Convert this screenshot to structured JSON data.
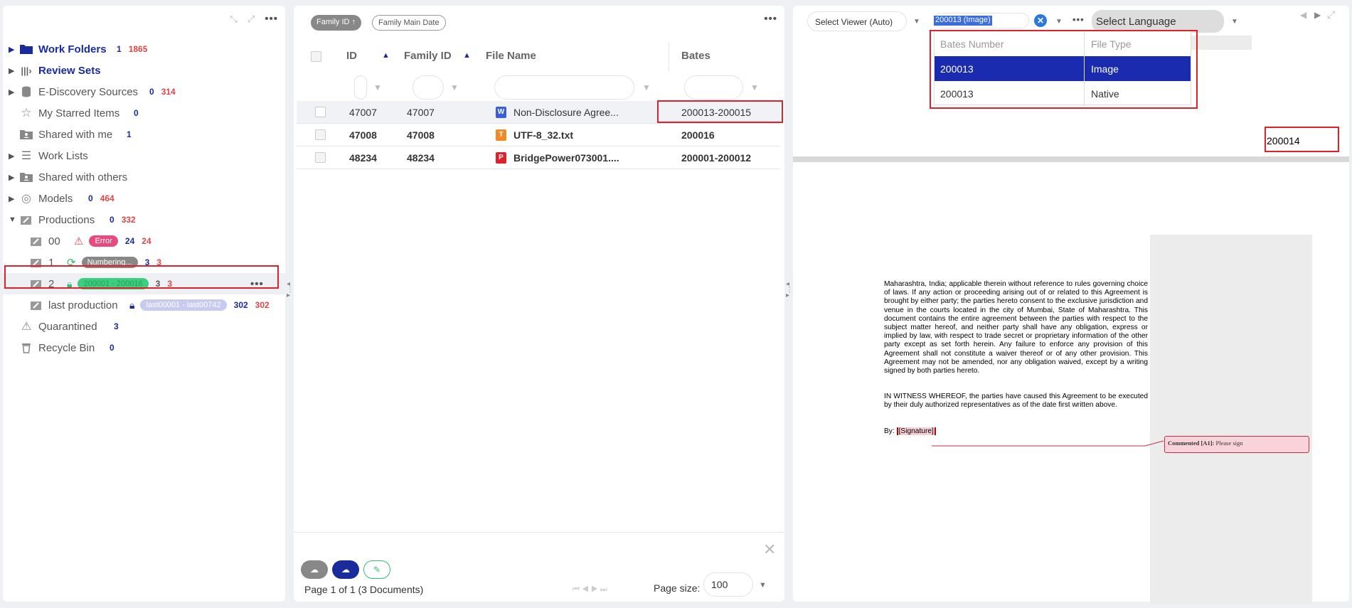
{
  "left": {
    "items": [
      {
        "label": "Work Folders",
        "c1": "1",
        "c2": "1865"
      },
      {
        "label": "Review Sets"
      },
      {
        "label": "E-Discovery Sources",
        "c1": "0",
        "c2": "314"
      },
      {
        "label": "My Starred Items",
        "c1": "0"
      },
      {
        "label": "Shared with me",
        "c1": "1"
      },
      {
        "label": "Work Lists"
      },
      {
        "label": "Shared with others"
      },
      {
        "label": "Models",
        "c1": "0",
        "c2": "464"
      },
      {
        "label": "Productions",
        "c1": "0",
        "c2": "332"
      },
      {
        "label": "00",
        "badge": "Error",
        "c1": "24",
        "c2": "24"
      },
      {
        "label": "1",
        "badge": "Numbering...",
        "c1": "3",
        "c2": "3"
      },
      {
        "label": "2",
        "badge": "200001 - 200016",
        "c1": "3",
        "c2": "3"
      },
      {
        "label": "last production",
        "badge": "last00001 - last00742",
        "c1": "302",
        "c2": "302"
      },
      {
        "label": "Quarantined",
        "c1": "3"
      },
      {
        "label": "Recycle Bin",
        "c1": "0"
      }
    ]
  },
  "mid": {
    "chips": {
      "family_id": "Family ID ↑",
      "family_date": "Family Main Date"
    },
    "columns": {
      "id": "ID",
      "family_id": "Family ID",
      "file_name": "File Name",
      "bates": "Bates"
    },
    "rows": [
      {
        "id": "47007",
        "family": "47007",
        "name": "Non-Disclosure Agree...",
        "bates": "200013-200015",
        "icon": "W"
      },
      {
        "id": "47008",
        "family": "47008",
        "name": "UTF-8_32.txt",
        "bates": "200016",
        "icon": "T"
      },
      {
        "id": "48234",
        "family": "48234",
        "name": "BridgePower073001....",
        "bates": "200001-200012",
        "icon": "P"
      }
    ],
    "pager": {
      "page_text": "Page 1 of 1 (3 Documents)",
      "size_label": "Page size:",
      "size_value": "100"
    }
  },
  "right": {
    "viewer": "Select Viewer (Auto)",
    "bates_value": "200013 (Image)",
    "language": "Select Language",
    "dropdown": {
      "headers": {
        "bates": "Bates Number",
        "type": "File Type"
      },
      "rows": [
        {
          "bates": "200013",
          "type": "Image"
        },
        {
          "bates": "200013",
          "type": "Native"
        }
      ]
    },
    "page_stamp": "200014",
    "doc": {
      "para1": "Maharashtra, India; applicable therein without reference to rules governing choice of laws. If any action or proceeding arising out of or related to this Agreement is brought by either party; the parties hereto consent to the exclusive jurisdiction and venue in the courts located in the city of Mumbai, State of Maharashtra. This document contains the entire agreement between the parties with respect to the subject matter hereof, and neither party shall have any obligation, express or implied by law, with respect to trade secret or proprietary information of the other party except as set forth herein. Any failure to enforce any provision of this Agreement shall not constitute a waiver thereof or of any other provision. This Agreement may not be amended, nor any obligation waived, except by a writing signed by both parties hereto.",
      "para2": "IN WITNESS WHEREOF, the parties have caused this Agreement to be executed by their duly authorized representatives as of the date first written above.",
      "by": "By:",
      "signature": "[Signature]",
      "comment_label": "Commented [A1]:",
      "comment_text": "Please sign"
    }
  }
}
